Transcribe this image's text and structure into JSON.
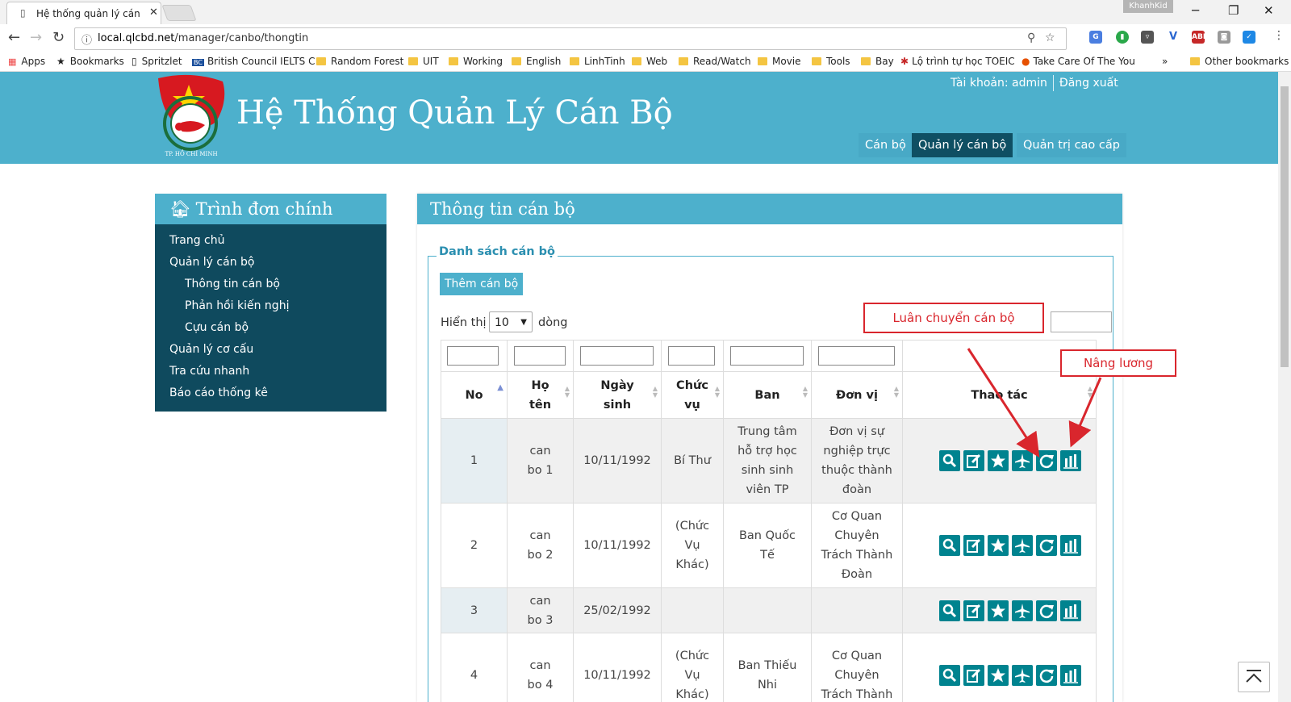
{
  "browser": {
    "tab_title": "Hệ thống quản lý cán bộ",
    "profile_name": "KhanhKid",
    "url_host": "local.qlcbd.net",
    "url_path": "/manager/canbo/thongtin",
    "bookmarks": [
      "Apps",
      "Bookmarks",
      "Spritzlet",
      "British Council IELTS C",
      "Random Forest",
      "UIT",
      "Working",
      "English",
      "LinhTinh",
      "Web",
      "Read/Watch",
      "Movie",
      "Tools",
      "Bay",
      "Lộ trình tự học TOEIC",
      "Take Care Of The You",
      "»",
      "Other bookmarks"
    ]
  },
  "header": {
    "title": "Hệ Thống Quản Lý Cán Bộ",
    "account_label": "Tài khoản: admin",
    "logout": "Đăng xuất",
    "logo_caption": "TP. HỒ CHÍ MINH",
    "nav": [
      "Cán bộ",
      "Quản lý cán bộ",
      "Quản trị cao cấp"
    ]
  },
  "sidebar": {
    "title": "Trình đơn chính",
    "items": [
      "Trang chủ",
      "Quản lý cán bộ",
      "Thông tin cán bộ",
      "Phản hồi kiến nghị",
      "Cựu cán bộ",
      "Quản lý cơ cấu",
      "Tra cứu nhanh",
      "Báo cáo thống kê"
    ]
  },
  "main": {
    "panel_title": "Thông tin cán bộ",
    "legend": "Danh sách cán bộ",
    "add_button": "Thêm cán bộ",
    "show_label": "Hiển thị",
    "page_size": "10",
    "rows_label": "dòng",
    "columns": [
      "No",
      "Họ tên",
      "Ngày sinh",
      "Chức vụ",
      "Ban",
      "Đơn vị",
      "Thao tác"
    ],
    "rows": [
      {
        "no": "1",
        "name": "can bo 1",
        "dob": "10/11/1992",
        "position": "Bí Thư",
        "dept": "Trung tâm hỗ trợ học sinh sinh viên TP",
        "unit": "Đơn vị sự nghiệp trực thuộc thành đoàn"
      },
      {
        "no": "2",
        "name": "can bo 2",
        "dob": "10/11/1992",
        "position": "(Chức Vụ Khác)",
        "dept": "Ban Quốc Tế",
        "unit": "Cơ Quan Chuyên Trách Thành Đoàn"
      },
      {
        "no": "3",
        "name": "can bo 3",
        "dob": "25/02/1992",
        "position": "",
        "dept": "",
        "unit": ""
      },
      {
        "no": "4",
        "name": "can bo 4",
        "dob": "10/11/1992",
        "position": "(Chức Vụ Khác)",
        "dept": "Ban Thiếu Nhi",
        "unit": "Cơ Quan Chuyên Trách Thành"
      }
    ],
    "action_icons": [
      "search-icon",
      "edit-icon",
      "star-icon",
      "airplane-icon",
      "refresh-icon",
      "chart-icon"
    ]
  },
  "annotations": {
    "transfer": "Luân chuyển cán bộ",
    "salary": "Nâng lương",
    "color": "#d9262d"
  },
  "colors": {
    "header_bg": "#4db0cc",
    "sidebar_bg": "#0f4a5e",
    "nav_active": "#0f4f63",
    "action_btn": "#00838f"
  }
}
